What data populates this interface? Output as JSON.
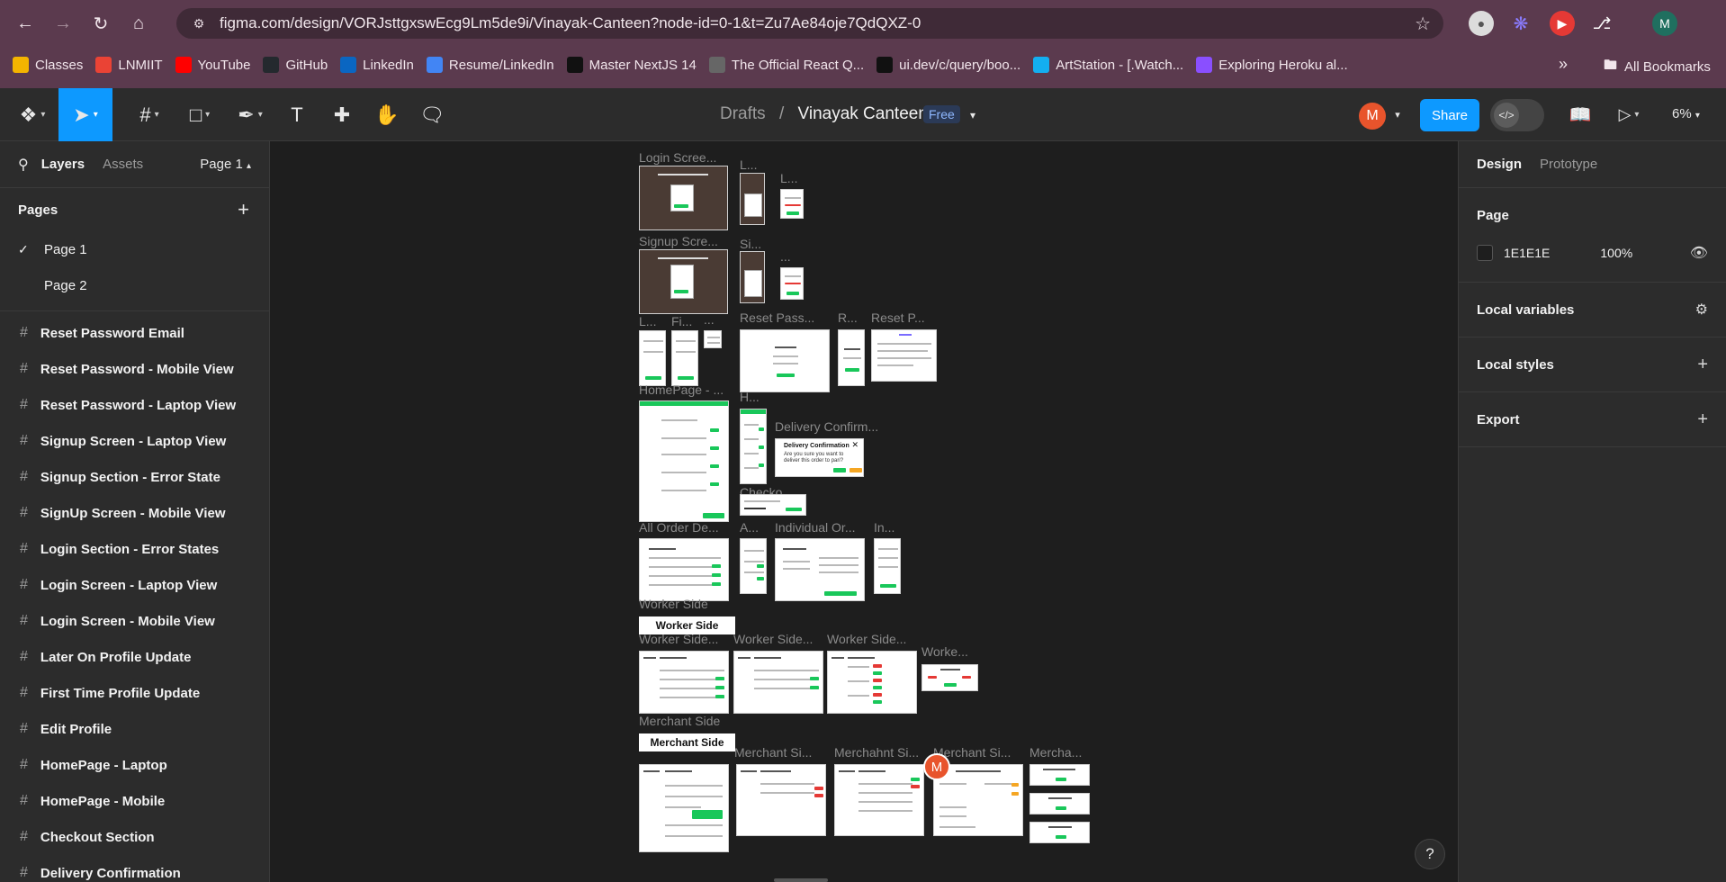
{
  "browser": {
    "url": "figma.com/design/VORJsttgxswEcg9Lm5de9i/Vinayak-Canteen?node-id=0-1&t=Zu7Ae84oje7QdQXZ-0",
    "profile_initial": "M",
    "bookmarks": [
      {
        "label": "Classes",
        "icon": "classroom-icon",
        "color": "#f4b400"
      },
      {
        "label": "LNMIIT",
        "icon": "gmail-icon",
        "color": "#ea4335"
      },
      {
        "label": "YouTube",
        "icon": "youtube-icon",
        "color": "#ff0000"
      },
      {
        "label": "GitHub",
        "icon": "github-icon",
        "color": "#24292e"
      },
      {
        "label": "LinkedIn",
        "icon": "linkedin-icon",
        "color": "#0a66c2"
      },
      {
        "label": "Resume/LinkedIn",
        "icon": "docs-icon",
        "color": "#4285f4"
      },
      {
        "label": "Master NextJS 14",
        "icon": "t-icon",
        "color": "#111111"
      },
      {
        "label": "The Official React Q...",
        "icon": "gear-icon",
        "color": "#666666"
      },
      {
        "label": "ui.dev/c/query/boo...",
        "icon": "ui-icon",
        "color": "#111111"
      },
      {
        "label": "ArtStation - [.Watch...",
        "icon": "artstation-icon",
        "color": "#13aff0"
      },
      {
        "label": "Exploring Heroku al...",
        "icon": "rocket-icon",
        "color": "#8a4fff"
      }
    ],
    "all_bookmarks": "All Bookmarks"
  },
  "figma": {
    "breadcrumb_drafts": "Drafts",
    "breadcrumb_sep": "/",
    "file_name": "Vinayak Canteen",
    "plan_badge": "Free",
    "user_initial": "M",
    "share_label": "Share",
    "zoom": "6%",
    "accent": "#0d99ff"
  },
  "left_panel": {
    "tab_layers": "Layers",
    "tab_assets": "Assets",
    "current_page": "Page 1",
    "pages_header": "Pages",
    "pages": [
      {
        "label": "Page 1",
        "selected": true
      },
      {
        "label": "Page 2",
        "selected": false
      }
    ],
    "layers": [
      "Reset Password Email",
      "Reset Password - Mobile View",
      "Reset Password - Laptop View",
      "Signup Screen - Laptop View",
      "Signup Section - Error State",
      "SignUp Screen - Mobile View",
      "Login Section - Error States",
      "Login Screen - Laptop View",
      "Login Screen - Mobile View",
      "Later On Profile Update",
      "First Time Profile Update",
      "Edit Profile",
      "HomePage - Laptop",
      "HomePage - Mobile",
      "Checkout Section",
      "Delivery Confirmation"
    ]
  },
  "right_panel": {
    "tab_design": "Design",
    "tab_prototype": "Prototype",
    "page_title": "Page",
    "page_fill_hex": "1E1E1E",
    "page_fill_opacity": "100%",
    "local_variables": "Local variables",
    "local_styles": "Local styles",
    "export": "Export"
  },
  "canvas": {
    "labels": {
      "login_screen": "Login Scree...",
      "l1": "L...",
      "l2": "L...",
      "signup_screen": "Signup Scre...",
      "si": "Si...",
      "dots": "...",
      "l3": "L...",
      "fi": "Fi...",
      "dots2": "...",
      "reset_pass": "Reset Pass...",
      "r": "R...",
      "reset_p": "Reset P...",
      "homepage": "HomePage - ...",
      "h": "H...",
      "delivery_confirm": "Delivery Confirm...",
      "checko": "Checko...",
      "all_order": "All Order De...",
      "a": "A...",
      "individual_or": "Individual Or...",
      "in": "In...",
      "worker_side_label": "Worker Side",
      "worker_side_1": "Worker Side...",
      "worker_side_2": "Worker Side...",
      "worker_side_3": "Worker Side...",
      "worke": "Worke...",
      "merchant_side_label": "Merchant Side",
      "merchant_si_1": "Merchant Si...",
      "merchant_si_2": "Merchahnt Si...",
      "merchant_si_3": "Merchant Si...",
      "mercha": "Mercha..."
    },
    "worker_side_header": "Worker Side",
    "merchant_side_header": "Merchant Side",
    "delivery_dialog_title": "Delivery Confirmation",
    "delivery_dialog_text": "Are you sure you want to deliver this order to pari?",
    "cursor_initial": "M",
    "help": "?"
  }
}
